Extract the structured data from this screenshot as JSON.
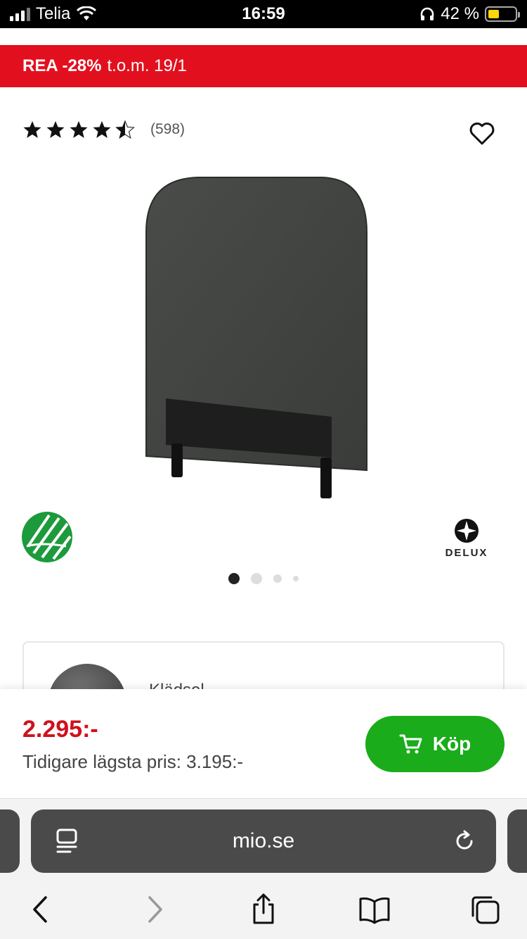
{
  "status_bar": {
    "carrier": "Telia",
    "time": "16:59",
    "battery_text": "42 %",
    "battery_level": 0.42,
    "battery_color": "#ffd60a"
  },
  "sale_banner": {
    "highlight": "REA -28%",
    "text": "t.o.m. 19/1",
    "color": "#e2101e"
  },
  "product": {
    "rating": 4.5,
    "rating_max": 5,
    "review_count": "(598)",
    "wishlist_icon": "heart-outline-icon",
    "image_description": "dark grey upholstered headboard on black legs",
    "badges": {
      "swan_icon": "nordic-swan-ecolabel-icon",
      "delux_text": "DELUX"
    },
    "carousel": {
      "total_slides": 4,
      "active_index": 0
    }
  },
  "option_card": {
    "label": "Klädsel"
  },
  "price_bar": {
    "price": "2.295:-",
    "previous_price": "Tidigare lägsta pris: 3.195:-",
    "buy_label": "Köp",
    "buy_icon": "cart-icon",
    "price_color": "#d0101c",
    "buy_color": "#1aac1a"
  },
  "browser": {
    "url": "mio.se",
    "toolbar": [
      "back-icon",
      "forward-icon",
      "share-icon",
      "bookmarks-icon",
      "tabs-icon"
    ]
  }
}
